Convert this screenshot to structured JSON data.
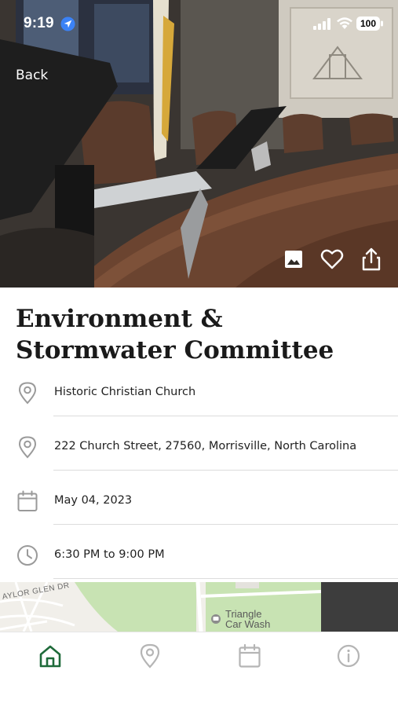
{
  "status_bar": {
    "time": "9:19",
    "battery": "100",
    "icons": [
      "location-arrow-icon",
      "signal-icon",
      "wifi-icon",
      "battery-icon"
    ]
  },
  "header": {
    "back_label": "Back",
    "actions": [
      "image-icon",
      "heart-icon",
      "share-icon"
    ]
  },
  "event": {
    "title": "Environment & Stormwater Committee",
    "details": [
      {
        "icon": "location-pin-icon",
        "text": "Historic Christian Church"
      },
      {
        "icon": "location-pin-icon",
        "text": "222 Church Street, 27560, Morrisville, North Carolina"
      },
      {
        "icon": "calendar-icon",
        "text": "May 04, 2023"
      },
      {
        "icon": "clock-icon",
        "text": "6:30 PM to 9:00 PM"
      }
    ]
  },
  "map": {
    "road_label": "AYLOR GLEN DR",
    "place_label_line1": "Triangle",
    "place_label_line2": "Car Wash"
  },
  "tab_bar": {
    "tabs": [
      {
        "name": "home",
        "icon": "home-icon",
        "active": true
      },
      {
        "name": "locations",
        "icon": "location-pin-icon",
        "active": false
      },
      {
        "name": "calendar",
        "icon": "calendar-icon",
        "active": false
      },
      {
        "name": "info",
        "icon": "info-icon",
        "active": false
      }
    ]
  },
  "colors": {
    "accent_active_tab": "#1f6b3a",
    "icon_gray": "#9a9a9a",
    "map_green": "#c8e3b3",
    "divider": "#dcdcdc"
  }
}
